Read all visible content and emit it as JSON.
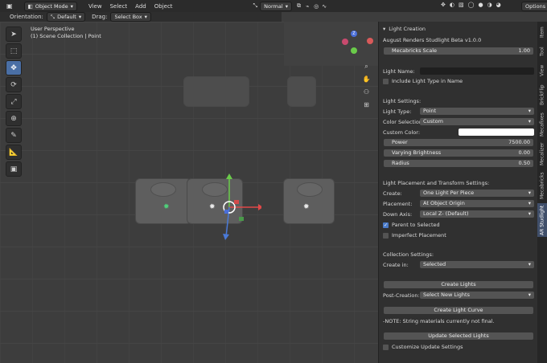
{
  "topbar": {
    "mode": "Object Mode",
    "menus": [
      "View",
      "Select",
      "Add",
      "Object"
    ],
    "transform": "Normal",
    "options": "Options"
  },
  "subbar": {
    "orientation_label": "Orientation:",
    "orientation_value": "Default",
    "drag_label": "Drag:",
    "drag_value": "Select Box"
  },
  "viewport": {
    "perspective": "User Perspective",
    "collection": "(1) Scene Collection | Point"
  },
  "panel": {
    "section_title": "Light Creation",
    "version": "August Renders Studlight Beta v1.0.0",
    "mecabricks_scale_label": "Mecabricks Scale",
    "mecabricks_scale_value": "1.00",
    "light_name_label": "Light Name:",
    "light_name_value": "",
    "include_type_label": "Include Light Type in Name",
    "light_settings_title": "Light Settings:",
    "light_type_label": "Light Type:",
    "light_type_value": "Point",
    "color_selection_label": "Color Selection:",
    "color_selection_value": "Custom",
    "custom_color_label": "Custom Color:",
    "custom_color_hex": "#ffffff",
    "power_label": "Power",
    "power_value": "7500.00",
    "varying_label": "Varying Brightness",
    "varying_value": "0.00",
    "radius_label": "Radius",
    "radius_value": "0.50",
    "placement_title": "Light Placement and Transform Settings:",
    "create_label": "Create:",
    "create_value": "One Light Per Piece",
    "placement_label": "Placement:",
    "placement_value": "At Object Origin",
    "down_axis_label": "Down Axis:",
    "down_axis_value": "Local Z- (Default)",
    "parent_label": "Parent to Selected",
    "imperfect_label": "Imperfect Placement",
    "collection_title": "Collection Settings:",
    "create_in_label": "Create in:",
    "create_in_value": "Selected",
    "create_lights_btn": "Create Lights",
    "post_creation_label": "Post-Creation:",
    "post_creation_value": "Select New Lights",
    "create_curve_btn": "Create Light Curve",
    "note": "-NOTE: String materials currently not final.",
    "update_btn": "Update Selected Lights",
    "customize_update_label": "Customize Update Settings"
  },
  "tabs": [
    "Item",
    "Tool",
    "View",
    "BrickFlip",
    "Mecafixes",
    "Mecalizer",
    "Mecabricks",
    "AR Studlight"
  ],
  "gizmo": {
    "x": "X",
    "y": "Y",
    "z": "Z"
  }
}
